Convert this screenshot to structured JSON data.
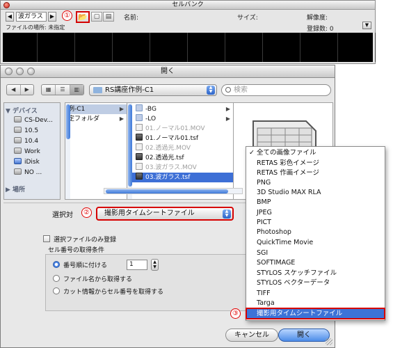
{
  "cellbank": {
    "title": "セルバンク",
    "name_field": "波ガラス",
    "prev_icon": "◀",
    "next_icon": "▶",
    "folder_icon": "📂",
    "tool_icon_a": "▢",
    "tool_icon_b": "▤",
    "location_label": "ファイルの場所: 未指定",
    "name_label": "名前:",
    "size_label": "サイズ:",
    "resolution_label": "解像度:",
    "count_label": "登録数: 0",
    "collapse_icon": "▼"
  },
  "annotations": {
    "step1": "①",
    "step2": "②",
    "step3": "③",
    "accent": "#d60000"
  },
  "dialog": {
    "title": "開く",
    "nav_back": "◀",
    "nav_forward": "▶",
    "view_icon": "▦",
    "view_list": "☰",
    "view_column": "▥",
    "path": "RS講座作例-C1",
    "search_placeholder": "検索",
    "sidebar": {
      "devices_header": "▼ デバイス",
      "places_header": "▶ 場所",
      "items": [
        "CS-Dev...",
        "10.5",
        "10.4",
        "Work",
        "iDisk",
        "NO ..."
      ]
    },
    "column1": {
      "items": [
        "例-C1",
        "定フォルダ"
      ]
    },
    "column2": {
      "items": [
        "-BG",
        "-LO",
        "01.ノーマル01.MOV",
        "01.ノーマル01.tsf",
        "02.透過光.MOV",
        "02.透過光.tsf",
        "03.波ガラス.MOV",
        "03.波ガラス.tsf"
      ]
    },
    "select_label": "選択対",
    "type_popup_value": "撮影用タイムシートファイル",
    "only_selected_label": "選択ファイルのみ登録",
    "group_title": "セル番号の取得条件",
    "radios": [
      "番号順に付ける",
      "ファイル名から取得する",
      "カット情報からセル番号を取得する"
    ],
    "number_value": "1",
    "cancel_button": "キャンセル",
    "open_button": "開く"
  },
  "type_menu": {
    "checkmark": "✓",
    "items": [
      "全ての画像ファイル",
      "RETAS 彩色イメージ",
      "RETAS 作画イメージ",
      "PNG",
      "3D Studio MAX RLA",
      "BMP",
      "JPEG",
      "PICT",
      "Photoshop",
      "QuickTime Movie",
      "SGI",
      "SOFTIMAGE",
      "STYLOS スケッチファイル",
      "STYLOS ベクターデータ",
      "TIFF",
      "Targa",
      "撮影用タイムシートファイル"
    ]
  }
}
